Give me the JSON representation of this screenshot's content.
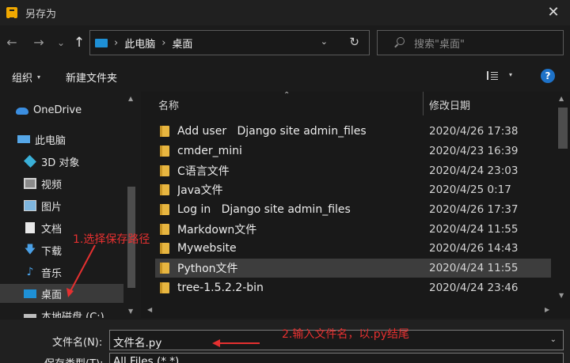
{
  "window": {
    "title": "另存为",
    "close": "✕"
  },
  "nav": {
    "back": "←",
    "forward": "→",
    "recent": "⌄",
    "up": "↑"
  },
  "address": {
    "crumbs": [
      "此电脑",
      "桌面"
    ],
    "separator": "›",
    "dropdown": "⌄",
    "refresh": "↻"
  },
  "search": {
    "placeholder": "搜索\"桌面\""
  },
  "toolbar": {
    "organize": "组织",
    "caret": "▾",
    "new_folder": "新建文件夹",
    "view_caret": "▾",
    "help": "?"
  },
  "sidebar": {
    "items": [
      {
        "label": "OneDrive",
        "icon": "cloud-icon"
      },
      {
        "label": "此电脑",
        "icon": "pc-icon"
      },
      {
        "label": "3D 对象",
        "icon": "cube-icon"
      },
      {
        "label": "视频",
        "icon": "video-icon"
      },
      {
        "label": "图片",
        "icon": "picture-icon"
      },
      {
        "label": "文档",
        "icon": "document-icon"
      },
      {
        "label": "下载",
        "icon": "download-icon"
      },
      {
        "label": "音乐",
        "icon": "music-icon"
      },
      {
        "label": "桌面",
        "icon": "desktop-icon"
      },
      {
        "label": "本地磁盘 (C:)",
        "icon": "disk-icon"
      }
    ],
    "download_glyph": "🡇",
    "music_glyph": "♪"
  },
  "filelist": {
    "headers": {
      "name": "名称",
      "date": "修改日期",
      "sort": "⌃"
    },
    "rows": [
      {
        "name": "Add user   Django site admin_files",
        "date": "2020/4/26 17:38"
      },
      {
        "name": "cmder_mini",
        "date": "2020/4/23 16:39"
      },
      {
        "name": "C语言文件",
        "date": "2020/4/24 23:03"
      },
      {
        "name": "Java文件",
        "date": "2020/4/25 0:17"
      },
      {
        "name": "Log in   Django site admin_files",
        "date": "2020/4/26 17:37"
      },
      {
        "name": "Markdown文件",
        "date": "2020/4/24 11:55"
      },
      {
        "name": "Mywebsite",
        "date": "2020/4/26 14:43"
      },
      {
        "name": "Python文件",
        "date": "2020/4/24 11:55"
      },
      {
        "name": "tree-1.5.2.2-bin",
        "date": "2020/4/24 23:46"
      }
    ],
    "selected_index": 7
  },
  "scroll": {
    "up": "▲",
    "down": "▼",
    "left": "◀",
    "right": "▶"
  },
  "fields": {
    "filename_label": "文件名(N):",
    "filename_value": "文件名.py",
    "filetype_label": "保存类型(T):",
    "filetype_value": "All Files (*.*)",
    "caret": "⌄"
  },
  "annotations": {
    "step1": "1.选择保存路径",
    "step2": "2.输入文件名，以.py结尾",
    "color": "#e53030"
  },
  "colors": {
    "accent": "#1e90d6",
    "folder": "#e8b640",
    "help": "#1e72c8"
  }
}
